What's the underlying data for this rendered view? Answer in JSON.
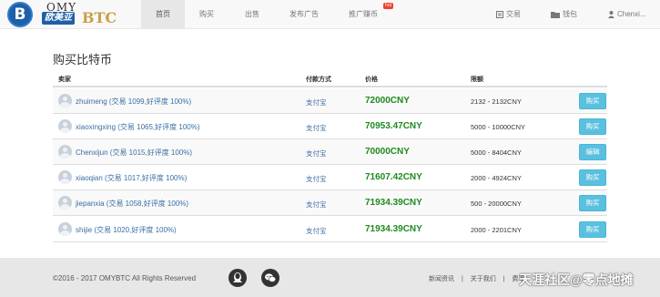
{
  "brand": {
    "top": "OMY",
    "cn": "欧美亚",
    "btc": "BTC",
    "coin_symbol": "B"
  },
  "nav": {
    "items": [
      {
        "label": "首页",
        "active": true
      },
      {
        "label": "购买"
      },
      {
        "label": "出售"
      },
      {
        "label": "发布广告"
      },
      {
        "label": "推广赚币",
        "badge": "hot"
      }
    ],
    "right": [
      {
        "label": "交易",
        "icon": "trade-icon"
      },
      {
        "label": "钱包",
        "icon": "wallet-icon"
      },
      {
        "label": "Chenxi...",
        "icon": "user-icon"
      }
    ]
  },
  "page_title": "购买比特币",
  "table": {
    "headers": {
      "seller": "卖家",
      "payment": "付款方式",
      "price": "价格",
      "limit": "限额"
    },
    "rows": [
      {
        "seller": "zhuimeng (交易 1099,好评度 100%)",
        "payment": "支付宝",
        "price": "72000CNY",
        "limit": "2132 - 2132CNY",
        "action": "购买"
      },
      {
        "seller": "xiaoxingxing (交易 1065,好评度 100%)",
        "payment": "支付宝",
        "price": "70953.47CNY",
        "limit": "5000 - 10000CNY",
        "action": "购买"
      },
      {
        "seller": "Chenxijun (交易 1015,好评度 100%)",
        "payment": "支付宝",
        "price": "70000CNY",
        "limit": "5000 - 8404CNY",
        "action": "编辑"
      },
      {
        "seller": "xiaoqian (交易 1017,好评度 100%)",
        "payment": "支付宝",
        "price": "71607.42CNY",
        "limit": "2000 - 4924CNY",
        "action": "购买"
      },
      {
        "seller": "jiepanxia (交易 1058,好评度 100%)",
        "payment": "支付宝",
        "price": "71934.39CNY",
        "limit": "500 - 20000CNY",
        "action": "购买"
      },
      {
        "seller": "shijie (交易 1020,好评度 100%)",
        "payment": "支付宝",
        "price": "71934.39CNY",
        "limit": "2000 - 2201CNY",
        "action": "购买"
      }
    ]
  },
  "footer": {
    "copyright": "©2016 - 2017 OMYBTC All Rights Reserved",
    "links": [
      "新闻资讯",
      "关于我们",
      "费率"
    ],
    "separator": "|",
    "social": [
      "qq-icon",
      "wechat-icon"
    ]
  },
  "watermark": "天涯社区@零点地摊",
  "colors": {
    "price": "#1e8a1e",
    "link": "#3a6ea5",
    "button": "#5bc0de",
    "brand": "#1f5fa8"
  }
}
